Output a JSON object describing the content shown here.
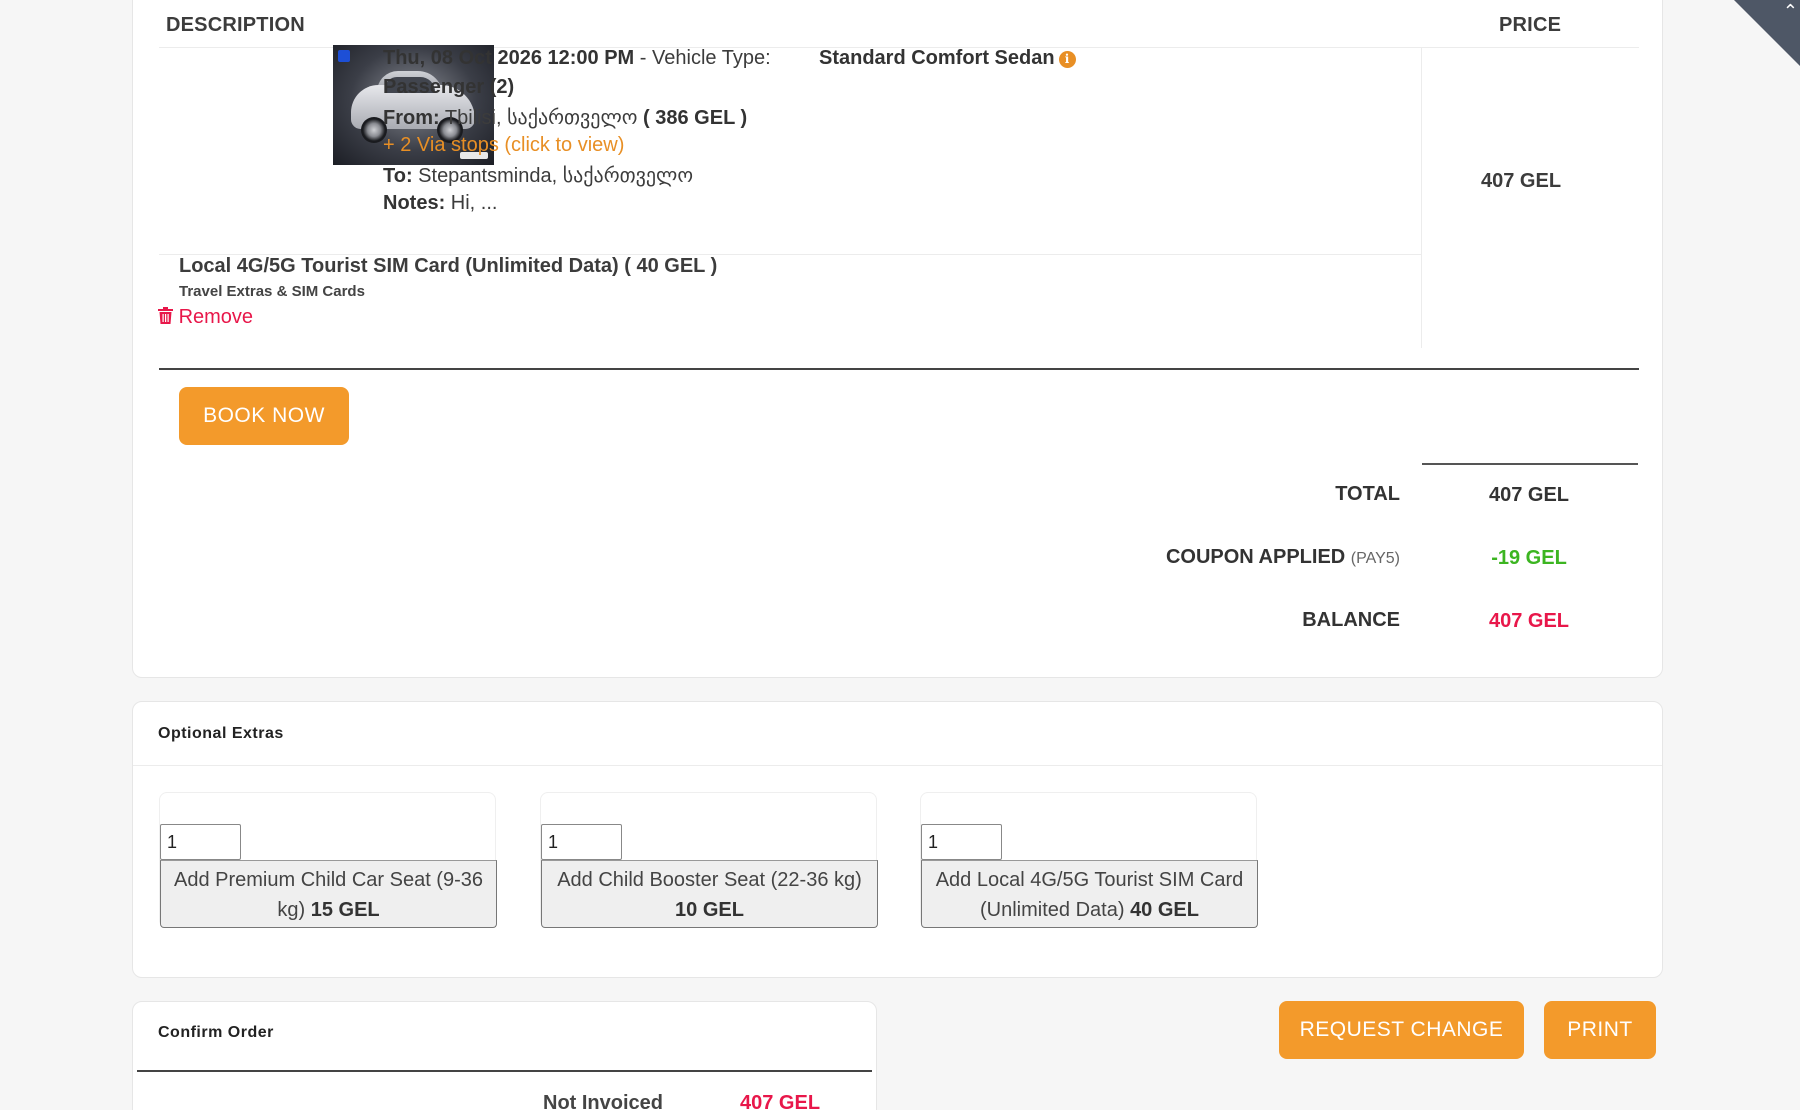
{
  "table": {
    "desc_header": "DESCRIPTION",
    "price_header": "PRICE"
  },
  "trip": {
    "datetime": "Thu, 08 Oct 2026 12:00 PM",
    "vehicle_type_sep": " - ",
    "vehicle_type_label": "Vehicle Type:",
    "vehicle_type": "Standard Comfort Sedan",
    "passenger": "Passenger (2)",
    "from_label": "From:",
    "from_value": " Tbilisi, საქართველო ",
    "from_price": "( 386 GEL )",
    "via_stops": "+ 2 Via stops (click to view)",
    "to_label": "To:",
    "to_value": " Stepantsminda, საქართველო",
    "notes_label": "Notes:",
    "notes_value": " Hi, ...",
    "price": "407 GEL"
  },
  "sim": {
    "title": "Local 4G/5G Tourist SIM Card (Unlimited Data) ( 40 GEL )",
    "category": "Travel Extras & SIM Cards",
    "remove_label": "Remove"
  },
  "book_now_label": "BOOK NOW",
  "summary": {
    "total_label": "TOTAL",
    "total_value": "407 GEL",
    "coupon_label": "COUPON APPLIED",
    "coupon_code": "(PAY5)",
    "coupon_value": "-19 GEL",
    "balance_label": "BALANCE",
    "balance_value": "407 GEL"
  },
  "extras": {
    "title": "Optional Extras",
    "items": [
      {
        "qty": "1",
        "label": "Add Premium Child Car Seat (9-36 kg)",
        "price": "15 GEL"
      },
      {
        "qty": "1",
        "label": "Add Child Booster Seat (22-36 kg)",
        "price": "10 GEL"
      },
      {
        "qty": "1",
        "label": "Add Local 4G/5G Tourist SIM Card (Unlimited Data)",
        "price": "40 GEL"
      }
    ]
  },
  "confirm": {
    "title": "Confirm Order",
    "status_label": "Not Invoiced",
    "status_value": "407 GEL"
  },
  "actions": {
    "request_change_label": "REQUEST CHANGE",
    "print_label": "PRINT"
  },
  "colors": {
    "accent_orange": "#f39a2b",
    "link_orange": "#e88f25",
    "coupon_green": "#3cb521",
    "balance_red": "#e8174a"
  }
}
